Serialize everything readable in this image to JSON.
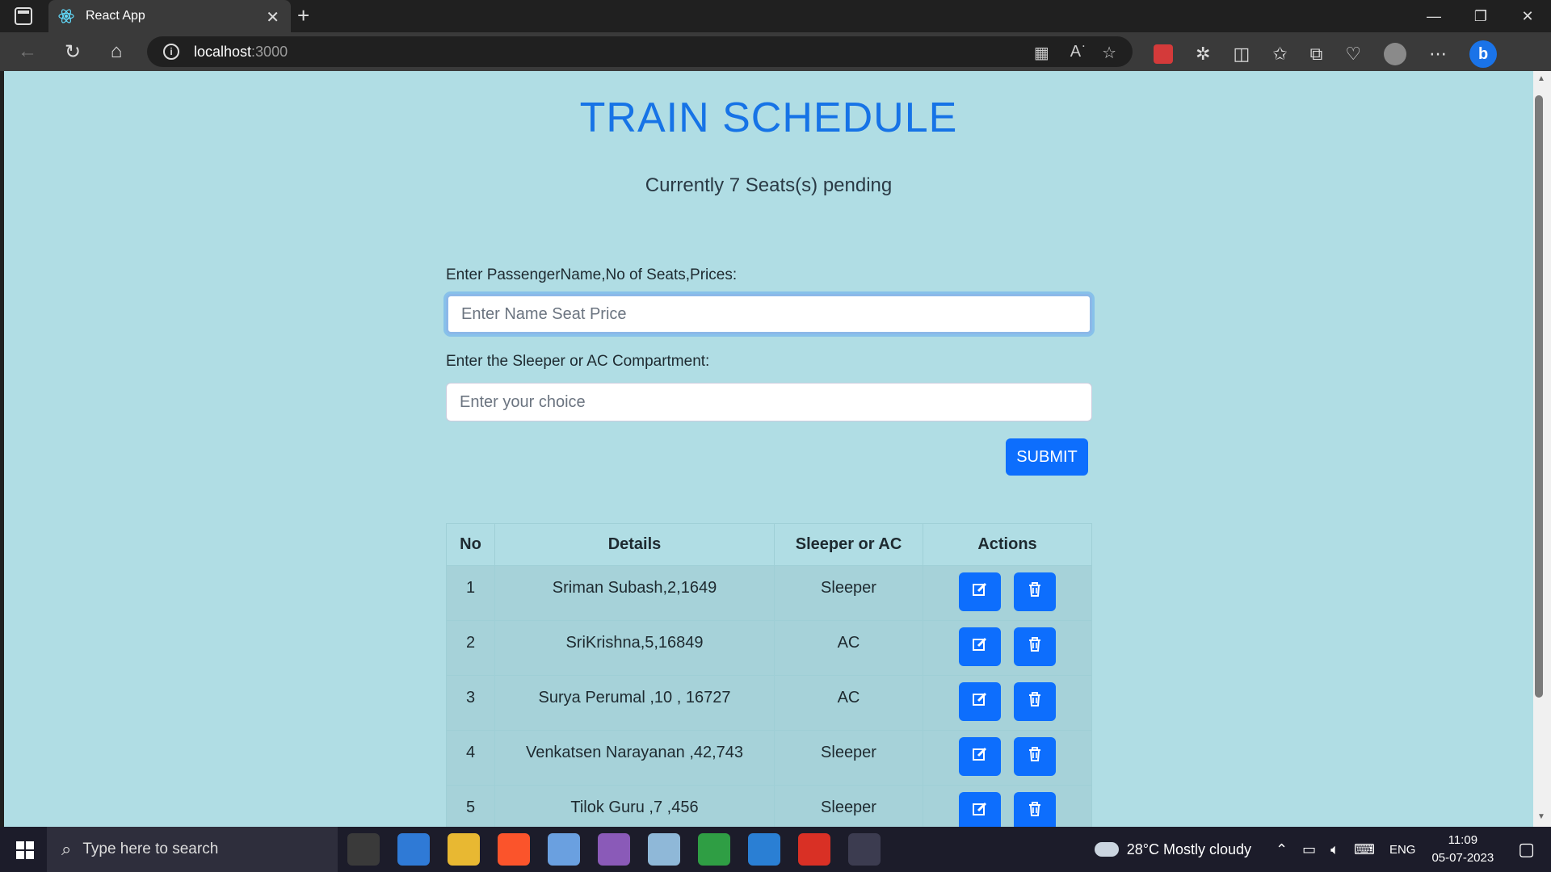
{
  "browser": {
    "tab_title": "React App",
    "url_host": "localhost",
    "url_port": ":3000"
  },
  "page": {
    "title": "TRAIN SCHEDULE",
    "subtitle": "Currently 7 Seats(s) pending",
    "form": {
      "label1": "Enter PassengerName,No of Seats,Prices:",
      "placeholder1": "Enter Name Seat Price",
      "label2": "Enter the Sleeper or AC Compartment:",
      "placeholder2": "Enter your choice",
      "submit": "SUBMIT"
    },
    "table": {
      "headers": [
        "No",
        "Details",
        "Sleeper or AC",
        "Actions"
      ],
      "rows": [
        {
          "no": "1",
          "details": "Sriman Subash,2,1649",
          "type": "Sleeper"
        },
        {
          "no": "2",
          "details": "SriKrishna,5,16849",
          "type": "AC"
        },
        {
          "no": "3",
          "details": "Surya Perumal ,10 , 16727",
          "type": "AC"
        },
        {
          "no": "4",
          "details": "Venkatsen Narayanan ,42,743",
          "type": "Sleeper"
        },
        {
          "no": "5",
          "details": "Tilok Guru ,7 ,456",
          "type": "Sleeper"
        }
      ]
    }
  },
  "taskbar": {
    "search_placeholder": "Type here to search",
    "weather": "28°C  Mostly cloudy",
    "lang": "ENG",
    "time": "11:09",
    "date": "05-07-2023"
  },
  "colors": {
    "page_bg": "#b0dde4",
    "accent": "#0d6efd",
    "title": "#1673e6"
  }
}
